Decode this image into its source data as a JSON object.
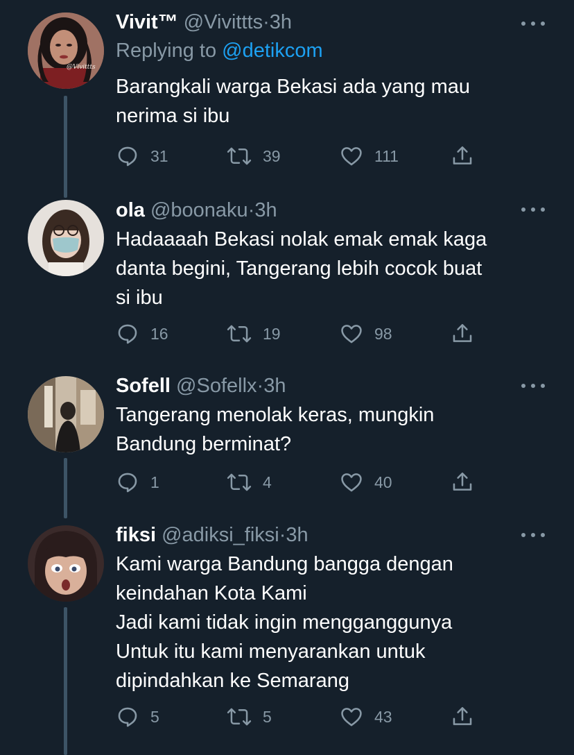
{
  "colors": {
    "background": "#15202b",
    "text_primary": "#ffffff",
    "text_secondary": "#8899a6",
    "link": "#1da1f2",
    "thread_line": "#3d5466"
  },
  "icons": {
    "reply": "reply-icon",
    "retweet": "retweet-icon",
    "like": "heart-icon",
    "share": "share-icon",
    "more": "more-options-icon"
  },
  "tweets": [
    {
      "name": "Vivit™",
      "handle": "@Vivittts",
      "separator": "·",
      "time": "3h",
      "replying_prefix": "Replying to",
      "replying_to": "@detikcom",
      "avatar_watermark": "@Vivittts",
      "lines": [
        "Barangkali warga Bekasi ada yang mau",
        "nerima si ibu"
      ],
      "replies": "31",
      "retweets": "39",
      "likes": "111"
    },
    {
      "name": "ola",
      "handle": "@boonaku",
      "separator": "·",
      "time": "3h",
      "lines": [
        "Hadaaaah Bekasi nolak emak emak kaga",
        "danta begini, Tangerang lebih cocok buat",
        "si ibu"
      ],
      "replies": "16",
      "retweets": "19",
      "likes": "98"
    },
    {
      "name": "Sofell",
      "handle": "@Sofellx",
      "separator": "·",
      "time": "3h",
      "lines": [
        "Tangerang menolak keras, mungkin",
        "Bandung berminat?"
      ],
      "replies": "1",
      "retweets": "4",
      "likes": "40"
    },
    {
      "name": "fiksi",
      "handle": "@adiksi_fiksi",
      "separator": "·",
      "time": "3h",
      "lines": [
        "Kami warga Bandung bangga dengan",
        "keindahan Kota Kami",
        "Jadi kami tidak ingin mengganggunya",
        "Untuk itu kami menyarankan untuk",
        "dipindahkan ke Semarang"
      ],
      "replies": "5",
      "retweets": "5",
      "likes": "43"
    }
  ]
}
